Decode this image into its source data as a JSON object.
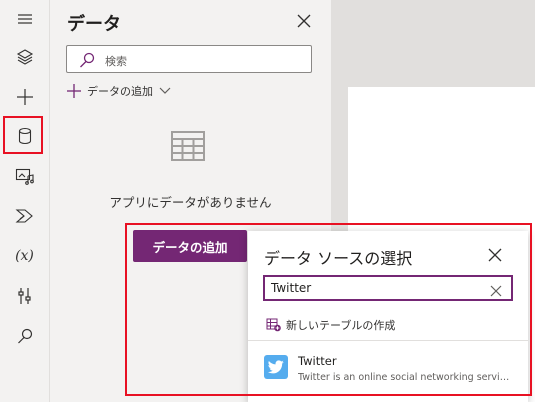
{
  "rail": {
    "items": [
      {
        "icon": "hamburger-menu-icon"
      },
      {
        "icon": "layers-icon"
      },
      {
        "icon": "plus-icon"
      },
      {
        "icon": "database-icon",
        "active": true
      },
      {
        "icon": "media-icon"
      },
      {
        "icon": "power-automate-icon"
      },
      {
        "icon": "variables-icon",
        "label": "(x)"
      },
      {
        "icon": "advanced-tools-icon"
      },
      {
        "icon": "search-icon"
      }
    ]
  },
  "panel": {
    "title": "データ",
    "search_placeholder": "検索",
    "add_data_link": "データの追加",
    "empty_message": "アプリにデータがありません",
    "add_data_button": "データの追加"
  },
  "popup": {
    "title": "データ ソースの選択",
    "search_value": "Twitter",
    "new_table": "新しいテーブルの作成",
    "results": [
      {
        "name": "Twitter",
        "description": "Twitter is an online social networking service t..."
      }
    ]
  },
  "colors": {
    "accent": "#742774",
    "highlight": "#e81123",
    "twitter": "#55acee"
  }
}
